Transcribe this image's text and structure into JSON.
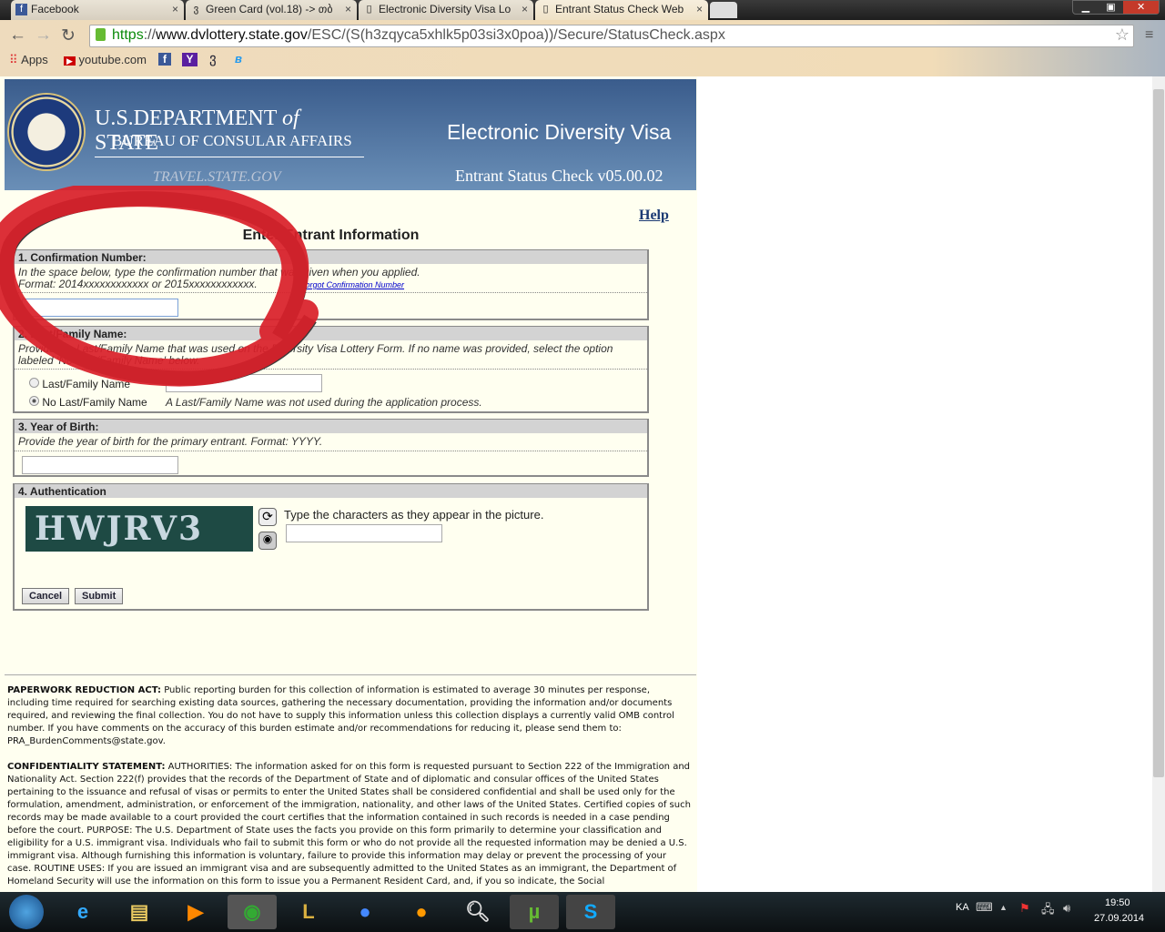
{
  "browser": {
    "tabs": [
      {
        "label": "Facebook",
        "icon": "facebook-icon"
      },
      {
        "label": "Green Card (vol.18) -> თბ",
        "icon": "georgian-site-icon"
      },
      {
        "label": "Electronic Diversity Visa Lo",
        "icon": "page-icon"
      },
      {
        "label": "Entrant Status Check Web",
        "icon": "page-icon"
      }
    ],
    "url_scheme": "https",
    "url_sep": "://",
    "url_domain": "www.dvlottery.state.gov",
    "url_path": "/ESC/(S(h3zqyca5xhlk5p03si3x0poa))/Secure/StatusCheck.aspx",
    "bookmarks": {
      "apps": "Apps",
      "youtube": "youtube.com"
    }
  },
  "header": {
    "dept": "U.S.DEPARTMENT",
    "of": "of",
    "state": "STATE",
    "bureau": "BUREAU OF CONSULAR AFFAIRS",
    "travel": "TRAVEL.STATE.GOV",
    "app_title": "Electronic Diversity Visa",
    "subtitle": "Entrant Status Check v05.00.02"
  },
  "form": {
    "help": "Help",
    "title": "Enter Entrant Information",
    "s1": {
      "title": "1. Confirmation Number:",
      "desc1": "In the space below, type the confirmation number that was given when you applied.",
      "desc2": "Format: 2014xxxxxxxxxxxx or 2015xxxxxxxxxxxx.",
      "forgot": "Forgot Confirmation Number",
      "value": ""
    },
    "s2": {
      "title": "2. Last/Family Name:",
      "desc": "Provide the Last/Family Name that was used on the Diversity Visa Lottery Form. If no name was provided, select the option labeled 'No Last/Family Name' below.",
      "opt1": "Last/Family Name",
      "opt2": "No Last/Family Name",
      "note": "A Last/Family Name was not used during the application process.",
      "selected": "No Last/Family Name"
    },
    "s3": {
      "title": "3. Year of Birth:",
      "desc": "Provide the year of birth for the primary entrant. Format: YYYY."
    },
    "s4": {
      "title": "4. Authentication",
      "captcha": "HWJRV3",
      "instr": "Type the characters as they appear in the picture."
    },
    "cancel": "Cancel",
    "submit": "Submit"
  },
  "footer": {
    "pra_label": "PAPERWORK REDUCTION ACT:",
    "pra_text": " Public reporting burden for this collection of information is estimated to average 30 minutes per response, including time required for searching existing data sources, gathering the necessary documentation, providing the information and/or documents required, and reviewing the final collection. You do not have to supply this information unless this collection displays a currently valid OMB control number. If you have comments on the accuracy of this burden estimate and/or recommendations for reducing it, please send them to: PRA_BurdenComments@state.gov.",
    "conf_label": "CONFIDENTIALITY STATEMENT:",
    "conf_text": "  AUTHORITIES: The information asked for on this form is requested pursuant to Section 222 of the Immigration and Nationality Act. Section 222(f) provides that the records of the Department of State and of diplomatic and consular offices of the United States pertaining to the issuance and refusal of visas or permits to enter the United States shall be considered confidential and shall be used only for the formulation, amendment, administration, or enforcement of the immigration, nationality, and other laws of the United States. Certified copies of such records may be made available to a court provided the court certifies that the information contained in such records is needed in a case pending before the court. PURPOSE: The U.S. Department of State uses the facts you provide on this form primarily to determine your classification and eligibility for a U.S. immigrant visa. Individuals who fail to submit this form or who do not provide all the requested information may be denied a U.S. immigrant visa. Although furnishing this information is voluntary, failure to provide this information may delay or prevent the processing of your case. ROUTINE USES: If you are issued an immigrant visa and are subsequently admitted to the United States as an immigrant, the Department of Homeland Security will use the information on this form to issue you a Permanent Resident Card, and, if you so indicate, the Social"
  },
  "taskbar": {
    "lang": "KA",
    "time": "19:50",
    "date": "27.09.2014"
  },
  "colors": {
    "annotation": "#d9202a",
    "header": "#3a5c8c",
    "page_bg": "#fffff0"
  }
}
